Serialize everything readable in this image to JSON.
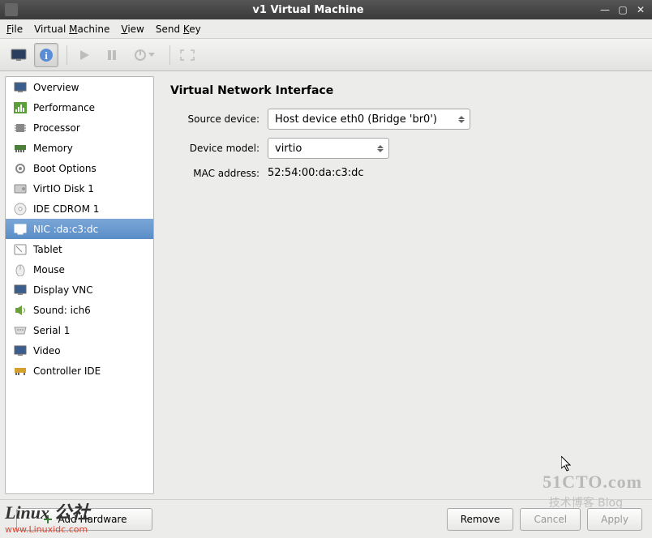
{
  "window": {
    "title": "v1 Virtual Machine"
  },
  "menubar": {
    "file": "File",
    "vm": "Virtual Machine",
    "view": "View",
    "sendkey": "Send Key"
  },
  "sidebar": {
    "items": [
      {
        "label": "Overview"
      },
      {
        "label": "Performance"
      },
      {
        "label": "Processor"
      },
      {
        "label": "Memory"
      },
      {
        "label": "Boot Options"
      },
      {
        "label": "VirtIO Disk 1"
      },
      {
        "label": "IDE CDROM 1"
      },
      {
        "label": "NIC :da:c3:dc"
      },
      {
        "label": "Tablet"
      },
      {
        "label": "Mouse"
      },
      {
        "label": "Display VNC"
      },
      {
        "label": "Sound: ich6"
      },
      {
        "label": "Serial 1"
      },
      {
        "label": "Video"
      },
      {
        "label": "Controller IDE"
      }
    ],
    "selected_index": 7,
    "add_hardware": "Add Hardware"
  },
  "panel": {
    "title": "Virtual Network Interface",
    "source_device_label": "Source device:",
    "source_device_value": "Host device eth0 (Bridge 'br0')",
    "device_model_label": "Device model:",
    "device_model_value": "virtio",
    "mac_label": "MAC address:",
    "mac_value": "52:54:00:da:c3:dc"
  },
  "footer": {
    "remove": "Remove",
    "cancel": "Cancel",
    "apply": "Apply"
  },
  "watermarks": {
    "cto": "51CTO.com",
    "blog": "技术博客 Blog",
    "linux": "Linux 公社",
    "linux_url": "www.Linuxidc.com"
  }
}
